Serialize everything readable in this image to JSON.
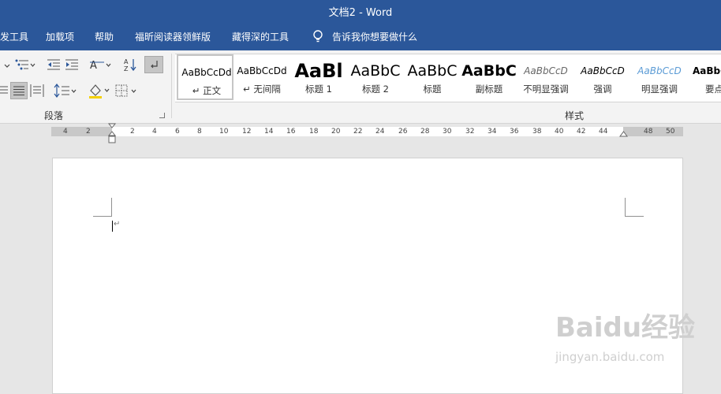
{
  "window": {
    "title": "文档2  -  Word"
  },
  "tabs": [
    {
      "label": "发工具"
    },
    {
      "label": "加载项"
    },
    {
      "label": "帮助"
    },
    {
      "label": "福昕阅读器领鲜版"
    },
    {
      "label": "藏得深的工具"
    }
  ],
  "tell_me": {
    "text": "告诉我你想要做什么"
  },
  "groups": {
    "paragraph": "段落",
    "styles": "样式"
  },
  "styles": [
    {
      "preview": "AaBbCcDd",
      "name": "↵ 正文"
    },
    {
      "preview": "AaBbCcDd",
      "name": "↵ 无间隔"
    },
    {
      "preview": "AaBl",
      "name": "标题 1"
    },
    {
      "preview": "AaBbC",
      "name": "标题 2"
    },
    {
      "preview": "AaBbC",
      "name": "标题"
    },
    {
      "preview": "AaBbC",
      "name": "副标题"
    },
    {
      "preview": "AaBbCcD",
      "name": "不明显强调"
    },
    {
      "preview": "AaBbCcD",
      "name": "强调"
    },
    {
      "preview": "AaBbCcD",
      "name": "明显强调"
    },
    {
      "preview": "AaBbC",
      "name": "要点"
    }
  ],
  "ruler": {
    "ticks": [
      "4",
      "2",
      "2",
      "4",
      "6",
      "8",
      "10",
      "12",
      "14",
      "16",
      "18",
      "20",
      "22",
      "24",
      "26",
      "28",
      "30",
      "32",
      "34",
      "36",
      "38",
      "40",
      "42",
      "44",
      "48",
      "50"
    ]
  },
  "watermark": {
    "logo": "Baidu经验",
    "url": "jingyan.baidu.com"
  },
  "colors": {
    "accent": "#2b579a",
    "ribbon": "#f3f3f3",
    "workspace": "#e6e6e6"
  }
}
